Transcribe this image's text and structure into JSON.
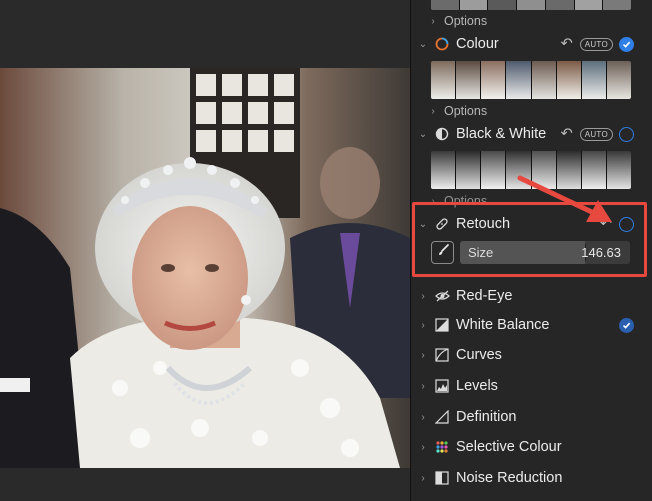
{
  "adjustments": {
    "top_options_label": "Options",
    "colour": {
      "label": "Colour",
      "auto": "AUTO",
      "options_label": "Options"
    },
    "black_white": {
      "label": "Black & White",
      "auto": "AUTO",
      "options_label": "Options"
    },
    "retouch": {
      "label": "Retouch",
      "size_label": "Size",
      "size_value": "146.63"
    },
    "sections": [
      {
        "label": "Red-Eye"
      },
      {
        "label": "White Balance"
      },
      {
        "label": "Curves"
      },
      {
        "label": "Levels"
      },
      {
        "label": "Definition"
      },
      {
        "label": "Selective Colour"
      },
      {
        "label": "Noise Reduction"
      }
    ]
  },
  "colors": {
    "accent": "#2f7fe6",
    "highlight_box": "#e8493f"
  },
  "icons": {
    "colour": "colour-circle-icon",
    "black_white": "half-circle-icon",
    "retouch": "bandage-icon",
    "red_eye": "eye-icon",
    "white_balance": "white-balance-icon",
    "curves": "curves-icon",
    "levels": "levels-icon",
    "definition": "definition-icon",
    "selective_colour": "selective-colour-icon",
    "noise_reduction": "noise-reduction-icon"
  }
}
